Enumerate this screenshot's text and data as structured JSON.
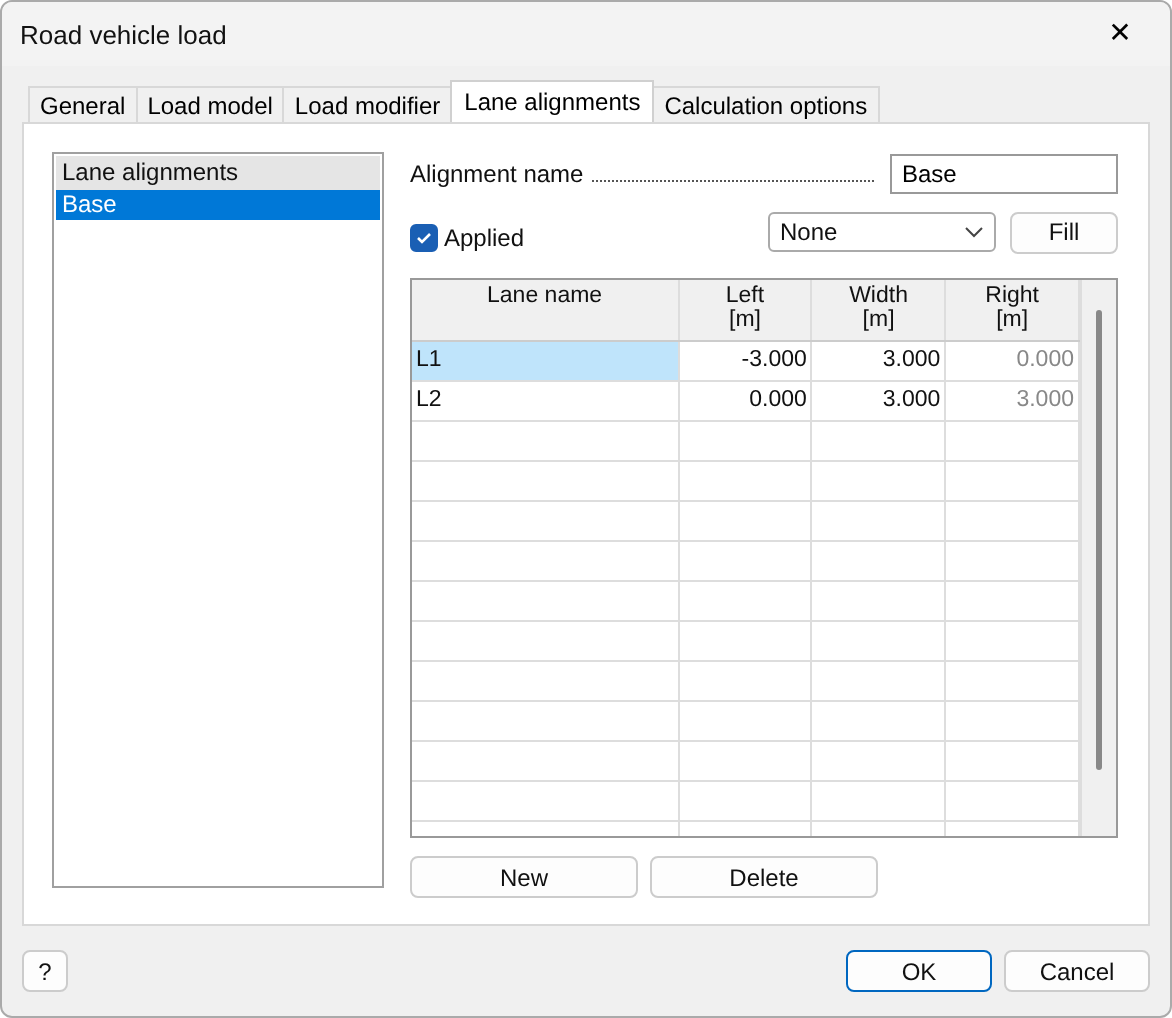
{
  "window": {
    "title": "Road vehicle load",
    "close": "✕"
  },
  "tabs": [
    {
      "label": "General",
      "selected": false
    },
    {
      "label": "Load model",
      "selected": false
    },
    {
      "label": "Load modifier",
      "selected": false
    },
    {
      "label": "Lane alignments",
      "selected": true
    },
    {
      "label": "Calculation options",
      "selected": false
    }
  ],
  "alignment_list": {
    "header": "Lane alignments",
    "items": [
      {
        "label": "Base",
        "selected": true
      }
    ]
  },
  "alignment_name": {
    "label": "Alignment name",
    "value": "Base"
  },
  "applied": {
    "label": "Applied",
    "checked": true
  },
  "preset": {
    "value": "None"
  },
  "fill_button": "Fill",
  "table": {
    "columns": [
      {
        "label": "Lane name",
        "readonly": false
      },
      {
        "label": "Left",
        "unit": "[m]",
        "readonly": false
      },
      {
        "label": "Width",
        "unit": "[m]",
        "readonly": false
      },
      {
        "label": "Right",
        "unit": "[m]",
        "readonly": true
      }
    ],
    "rows": [
      {
        "selected": true,
        "cells": [
          "L1",
          "-3.000",
          "3.000",
          "0.000"
        ]
      },
      {
        "selected": false,
        "cells": [
          "L2",
          "0.000",
          "3.000",
          "3.000"
        ]
      }
    ]
  },
  "table_buttons": [
    "New",
    "Delete"
  ],
  "help_button": "?",
  "buttons": [
    {
      "label": "OK",
      "default": true
    },
    {
      "label": "Cancel",
      "default": false
    }
  ]
}
